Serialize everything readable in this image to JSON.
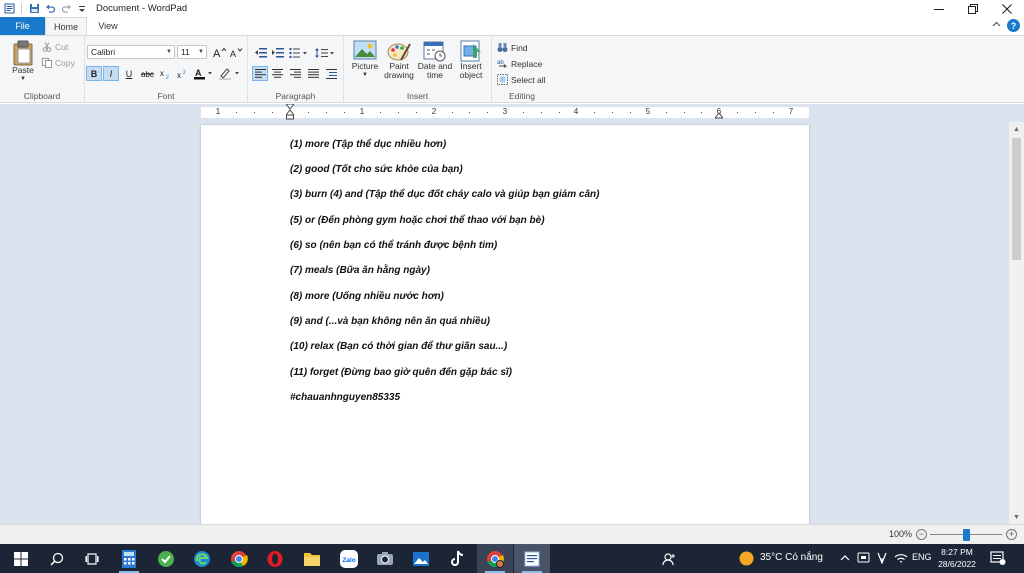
{
  "window": {
    "title": "Document - WordPad"
  },
  "tabs": {
    "file": "File",
    "home": "Home",
    "view": "View"
  },
  "ribbon": {
    "clipboard": {
      "label": "Clipboard",
      "paste": "Paste",
      "cut": "Cut",
      "copy": "Copy"
    },
    "font": {
      "label": "Font",
      "family": "Calibri",
      "size": "11"
    },
    "paragraph": {
      "label": "Paragraph"
    },
    "insert": {
      "label": "Insert",
      "picture": "Picture",
      "paint_drawing_1": "Paint",
      "paint_drawing_2": "drawing",
      "date_time_1": "Date and",
      "date_time_2": "time",
      "insert_object_1": "Insert",
      "insert_object_2": "object"
    },
    "editing": {
      "label": "Editing",
      "find": "Find",
      "replace": "Replace",
      "select_all": "Select all"
    }
  },
  "ruler": {
    "numbers": [
      "1",
      "1",
      "2",
      "3",
      "4",
      "5",
      "6",
      "7"
    ]
  },
  "document": {
    "lines": [
      "(1) more (Tập thể dục nhiều hơn)",
      "(2) good (Tốt cho sức khỏe của bạn)",
      "(3) burn (4) and (Tập thể dục đốt cháy calo và giúp bạn giảm cân)",
      "(5) or (Đến phòng gym hoặc chơi thể thao với bạn bè)",
      "(6) so (nên bạn có thể tránh được bệnh tim)",
      "(7) meals (Bữa ăn hằng ngày)",
      "(8) more (Uống nhiều nước hơn)",
      "(9) and (...và bạn không nên ăn quá nhiều)",
      "(10) relax (Bạn có thời gian để thư giãn sau...)",
      "(11) forget (Đừng bao giờ quên đến gặp bác sĩ)",
      "#chauanhnguyen85335"
    ]
  },
  "status": {
    "zoom": "100%"
  },
  "taskbar": {
    "weather": "35°C  Có nắng",
    "language": "ENG",
    "time": "8:27 PM",
    "date": "28/6/2022",
    "zalo_label": "Zalo"
  },
  "colors": {
    "accent": "#1979ca",
    "workspace": "#dbe3ee",
    "taskbar": "#1c2535"
  }
}
